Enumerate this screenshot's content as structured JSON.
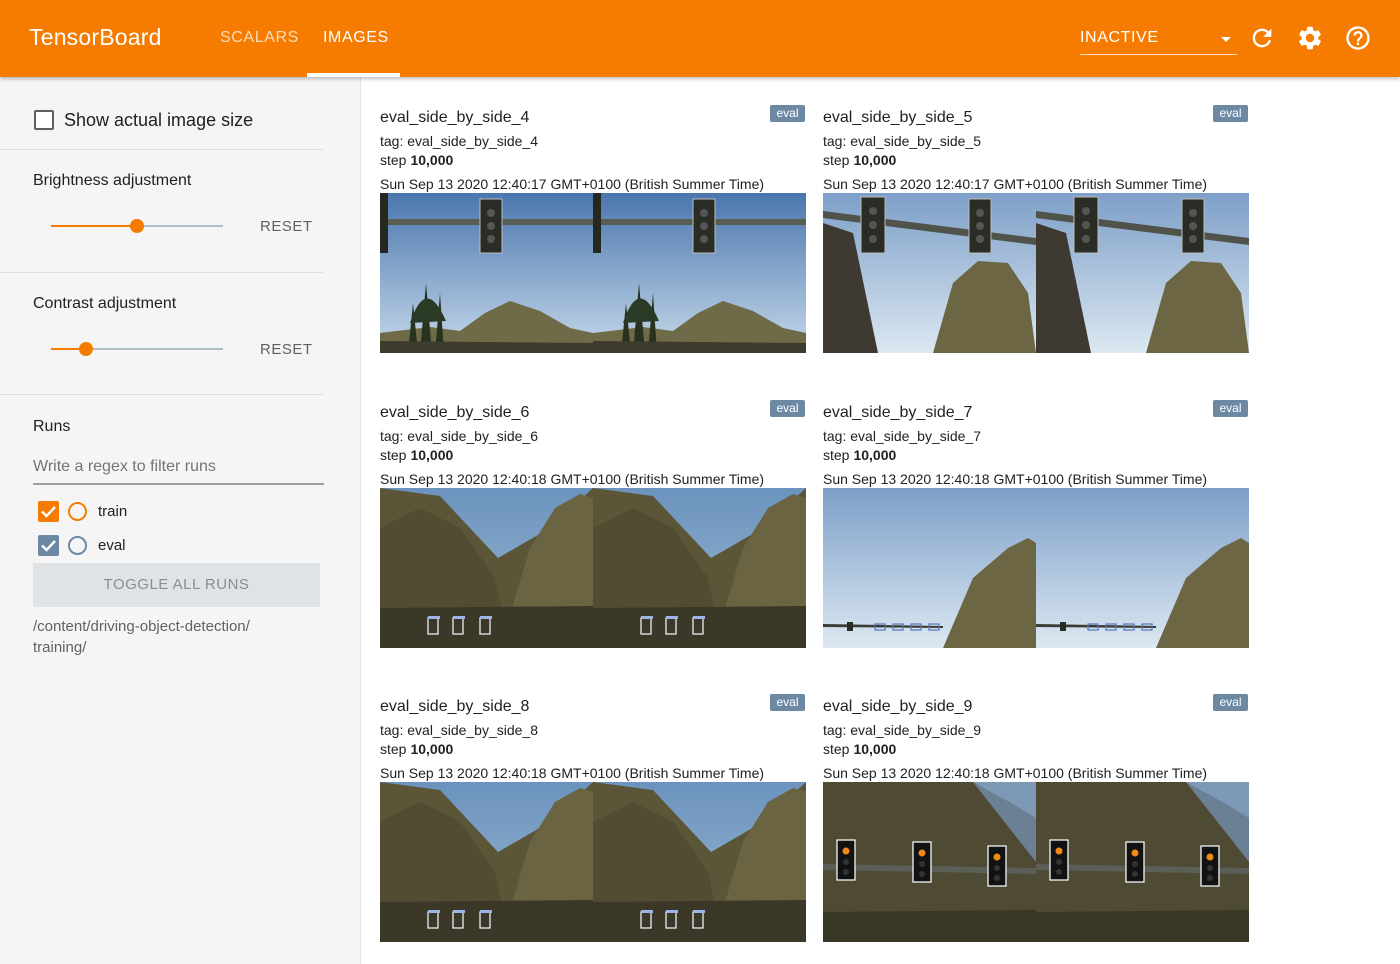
{
  "app": {
    "title": "TensorBoard",
    "tabs": [
      "SCALARS",
      "IMAGES"
    ],
    "active_tab": "IMAGES",
    "reload_state": "INACTIVE",
    "accent_color": "#f57c00",
    "icons": [
      "chevron-down-icon",
      "refresh-icon",
      "settings-icon",
      "help-icon"
    ]
  },
  "sidebar": {
    "show_actual_size_label": "Show actual image size",
    "show_actual_size_checked": false,
    "brightness": {
      "label": "Brightness adjustment",
      "value_fraction": 0.5,
      "reset_label": "RESET"
    },
    "contrast": {
      "label": "Contrast adjustment",
      "value_fraction": 0.2,
      "reset_label": "RESET"
    },
    "runs": {
      "title": "Runs",
      "filter_placeholder": "Write a regex to filter runs",
      "items": [
        {
          "name": "train",
          "checked": true,
          "color": "#f57c00"
        },
        {
          "name": "eval",
          "checked": true,
          "color": "#6d88a3"
        }
      ],
      "toggle_all_label": "TOGGLE ALL RUNS",
      "logdir_line1": "/content/driving-object-detection/",
      "logdir_line2": "training/"
    }
  },
  "cards": [
    {
      "title": "eval_side_by_side_4",
      "tag": "tag: eval_side_by_side_4",
      "step_label": "step",
      "step": "10,000",
      "time": "Sun Sep 13 2020 12:40:17 GMT+0100 (British Summer Time)",
      "run": "eval",
      "scene": "lights-sky-trees"
    },
    {
      "title": "eval_side_by_side_5",
      "tag": "tag: eval_side_by_side_5",
      "step_label": "step",
      "step": "10,000",
      "time": "Sun Sep 13 2020 12:40:17 GMT+0100 (British Summer Time)",
      "run": "eval",
      "scene": "lights-rock"
    },
    {
      "title": "eval_side_by_side_6",
      "tag": "tag: eval_side_by_side_6",
      "step_label": "step",
      "step": "10,000",
      "time": "Sun Sep 13 2020 12:40:18 GMT+0100 (British Summer Time)",
      "run": "eval",
      "scene": "mountains-boxes"
    },
    {
      "title": "eval_side_by_side_7",
      "tag": "tag: eval_side_by_side_7",
      "step_label": "step",
      "step": "10,000",
      "time": "Sun Sep 13 2020 12:40:18 GMT+0100 (British Summer Time)",
      "run": "eval",
      "scene": "sky-rock-road"
    },
    {
      "title": "eval_side_by_side_8",
      "tag": "tag: eval_side_by_side_8",
      "step_label": "step",
      "step": "10,000",
      "time": "Sun Sep 13 2020 12:40:18 GMT+0100 (British Summer Time)",
      "run": "eval",
      "scene": "mountains-boxes"
    },
    {
      "title": "eval_side_by_side_9",
      "tag": "tag: eval_side_by_side_9",
      "step_label": "step",
      "step": "10,000",
      "time": "Sun Sep 13 2020 12:40:18 GMT+0100 (British Summer Time)",
      "run": "eval",
      "scene": "dark-lights"
    }
  ]
}
